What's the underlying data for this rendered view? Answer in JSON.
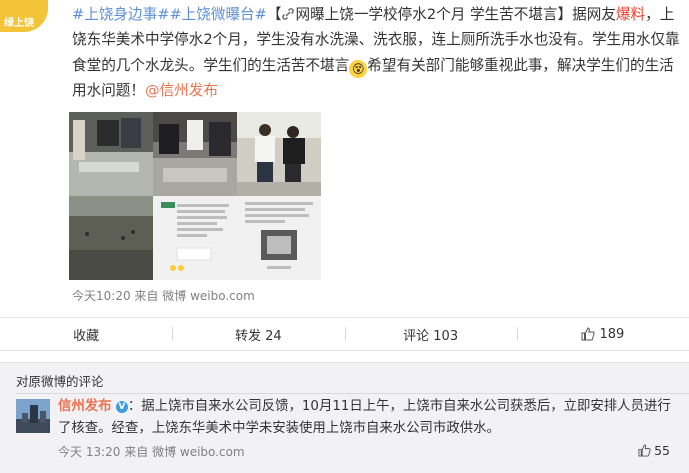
{
  "avatar": {
    "text": "绿上饶"
  },
  "post": {
    "tag1": "#上饶身边事#",
    "tag2": "#上饶微曝台#",
    "bracket_open": "【",
    "headline": "网曝上饶一学校停水2个月 学生苦不堪言",
    "bracket_close": "】",
    "text_a": "据网友",
    "text_highlight": "爆料",
    "text_b": "，上饶东华美术中学停水2个月，学生没有水洗澡、洗衣服，连上厕所洗手水也没有。学生用水仅靠食堂的几个水龙头。学生们的生活苦不堪言",
    "text_c": "希望有关部门能够重视此事，解决学生们的生活用水问题！",
    "mention": "@信州发布",
    "emoji": "😵"
  },
  "meta": {
    "time": "今天10:20",
    "source_prefix": "来自",
    "source": "微博 weibo.com"
  },
  "actions": {
    "collect": "收藏",
    "repost": "转发 24",
    "comment": "评论 103",
    "like": "189"
  },
  "comments": {
    "title": "对原微博的评论",
    "item": {
      "user": "信州发布",
      "verified": "V",
      "text": "：据上饶市自来水公司反馈，10月11日上午，上饶市自来水公司获悉后，立即安排人员进行了核查。经查，上饶东华美术中学未安装使用上饶市自来水公司市政供水。",
      "time": "今天 13:20",
      "source_prefix": "来自",
      "source": "微博 weibo.com",
      "likes": "55"
    }
  },
  "colors": {
    "accent": "#eb7350",
    "tag": "#5d8fd6",
    "highlight": "#e8432e",
    "comments_bg": "#f2f2f5"
  },
  "icons": [
    "chain-link-icon",
    "thumbs-up-icon",
    "verified-v-icon",
    "dizzy-emoji-icon"
  ]
}
